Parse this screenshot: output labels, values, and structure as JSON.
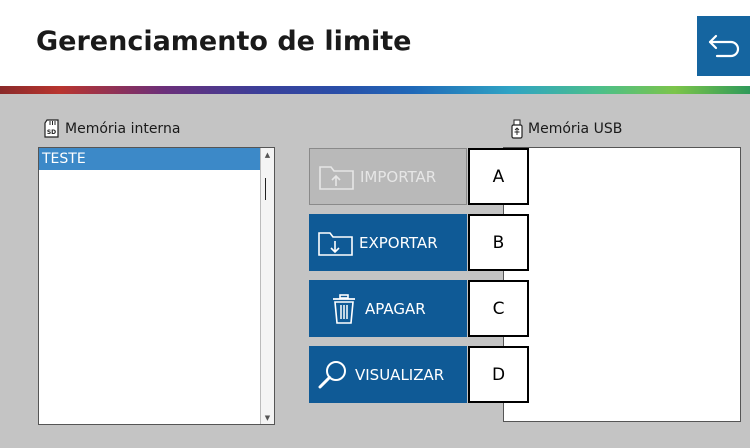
{
  "header": {
    "title": "Gerenciamento de limite",
    "back_icon": "return-arrow-icon",
    "accent_color": "#1565a0"
  },
  "internal_memory": {
    "label": "Memória interna",
    "icon": "sd-card-icon",
    "items": [
      {
        "label": "TESTE",
        "selected": true
      }
    ]
  },
  "usb_memory": {
    "label": "Memória USB",
    "icon": "usb-drive-icon",
    "items": []
  },
  "actions": {
    "import": {
      "label": "IMPORTAR",
      "icon": "folder-import-icon",
      "enabled": false
    },
    "export": {
      "label": "EXPORTAR",
      "icon": "folder-export-icon",
      "enabled": true
    },
    "delete": {
      "label": "APAGAR",
      "icon": "trash-icon",
      "enabled": true
    },
    "view": {
      "label": "VISUALIZAR",
      "icon": "magnifier-icon",
      "enabled": true
    }
  },
  "callouts": {
    "a": "A",
    "b": "B",
    "c": "C",
    "d": "D"
  },
  "colors": {
    "button_active": "#0f5a96",
    "button_disabled": "#b9b9b9",
    "selection": "#3c89c8",
    "panel_bg": "#c4c4c4"
  }
}
